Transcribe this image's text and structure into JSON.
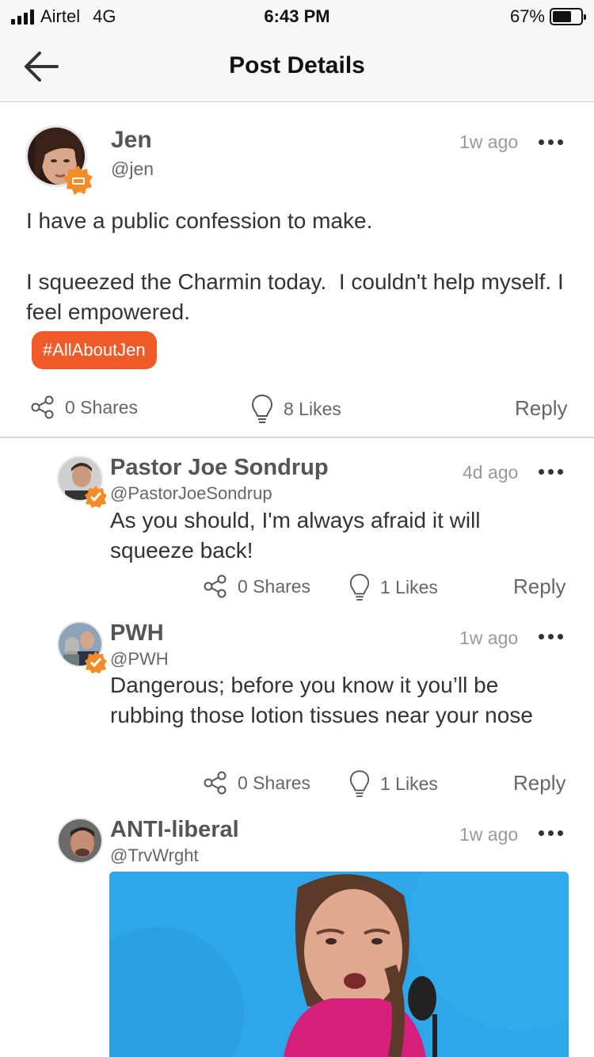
{
  "status": {
    "carrier": "Airtel",
    "network": "4G",
    "time": "6:43 PM",
    "battery_percent": "67%",
    "battery_level": 0.67
  },
  "nav": {
    "title": "Post Details",
    "back_icon": "arrow-left-icon"
  },
  "post": {
    "author_name": "Jen",
    "author_handle": "@jen",
    "time": "1w ago",
    "text_line1": "I have a public confession to make.",
    "text_line2": "I squeezed the Charmin today.  I couldn't help myself. I feel empowered.",
    "hashtag": "#AllAboutJen",
    "shares": "0 Shares",
    "likes": "8 Likes",
    "reply_label": "Reply",
    "accent_color": "#f05a28"
  },
  "comments": [
    {
      "author_name": "Pastor Joe Sondrup",
      "author_handle": "@PastorJoeSondrup",
      "time": "4d ago",
      "text": "As you should, I'm always afraid it will squeeze back!",
      "shares": "0 Shares",
      "likes": "1 Likes",
      "reply_label": "Reply"
    },
    {
      "author_name": "PWH",
      "author_handle": "@PWH",
      "time": "1w ago",
      "text": "Dangerous; before you know it you’ll be rubbing those lotion tissues near your nose",
      "shares": "0 Shares",
      "likes": "1 Likes",
      "reply_label": "Reply"
    },
    {
      "author_name": "ANTI-liberal",
      "author_handle": "@TrvWrght",
      "time": "1w ago"
    }
  ]
}
